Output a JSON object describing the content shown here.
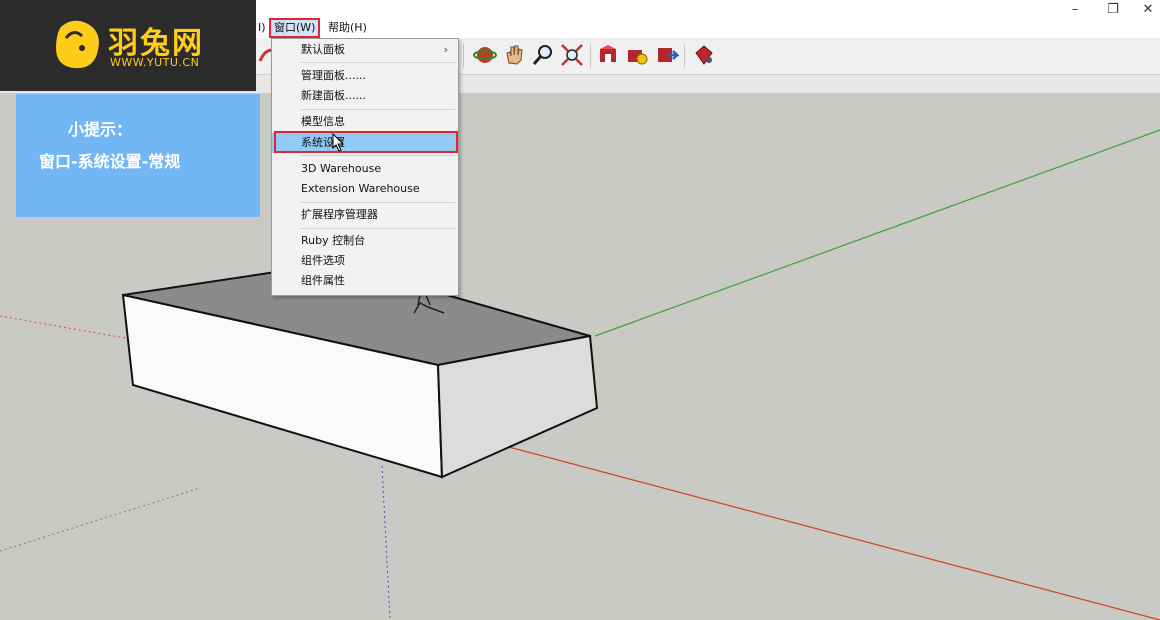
{
  "logo": {
    "name": "羽兔网",
    "url": "WWW.YUTU.CN",
    "color": "#ffcc1a"
  },
  "tip": {
    "title": "小提示：",
    "text": "窗口-系统设置-常规"
  },
  "menubar": {
    "partial_label": "I)",
    "items": [
      {
        "label": "窗口(W)",
        "highlighted": true
      },
      {
        "label": "帮助(H)"
      }
    ]
  },
  "window_controls": [
    "minimize-icon",
    "restore-icon",
    "close-icon"
  ],
  "dropdown": {
    "items": [
      {
        "label": "默认面板",
        "has_submenu": true
      },
      {
        "label": "管理面板......"
      },
      {
        "label": "新建面板......"
      },
      {
        "label": "模型信息"
      },
      {
        "label": "系统设置",
        "highlighted": true
      },
      {
        "label": "3D Warehouse"
      },
      {
        "label": "Extension Warehouse"
      },
      {
        "label": "扩展程序管理器"
      },
      {
        "label": "Ruby 控制台"
      },
      {
        "label": "组件选项"
      },
      {
        "label": "组件属性"
      }
    ]
  },
  "toolbar_icons": [
    "orbit-icon",
    "pan-icon",
    "zoom-icon",
    "zoom-extents-icon",
    "3d-warehouse-icon",
    "share-component-icon",
    "upload-model-icon",
    "extension-warehouse-icon"
  ],
  "colors": {
    "highlight_border": "#e0262e",
    "tip_background": "#72b6f4",
    "selection": "#91c9f7"
  }
}
